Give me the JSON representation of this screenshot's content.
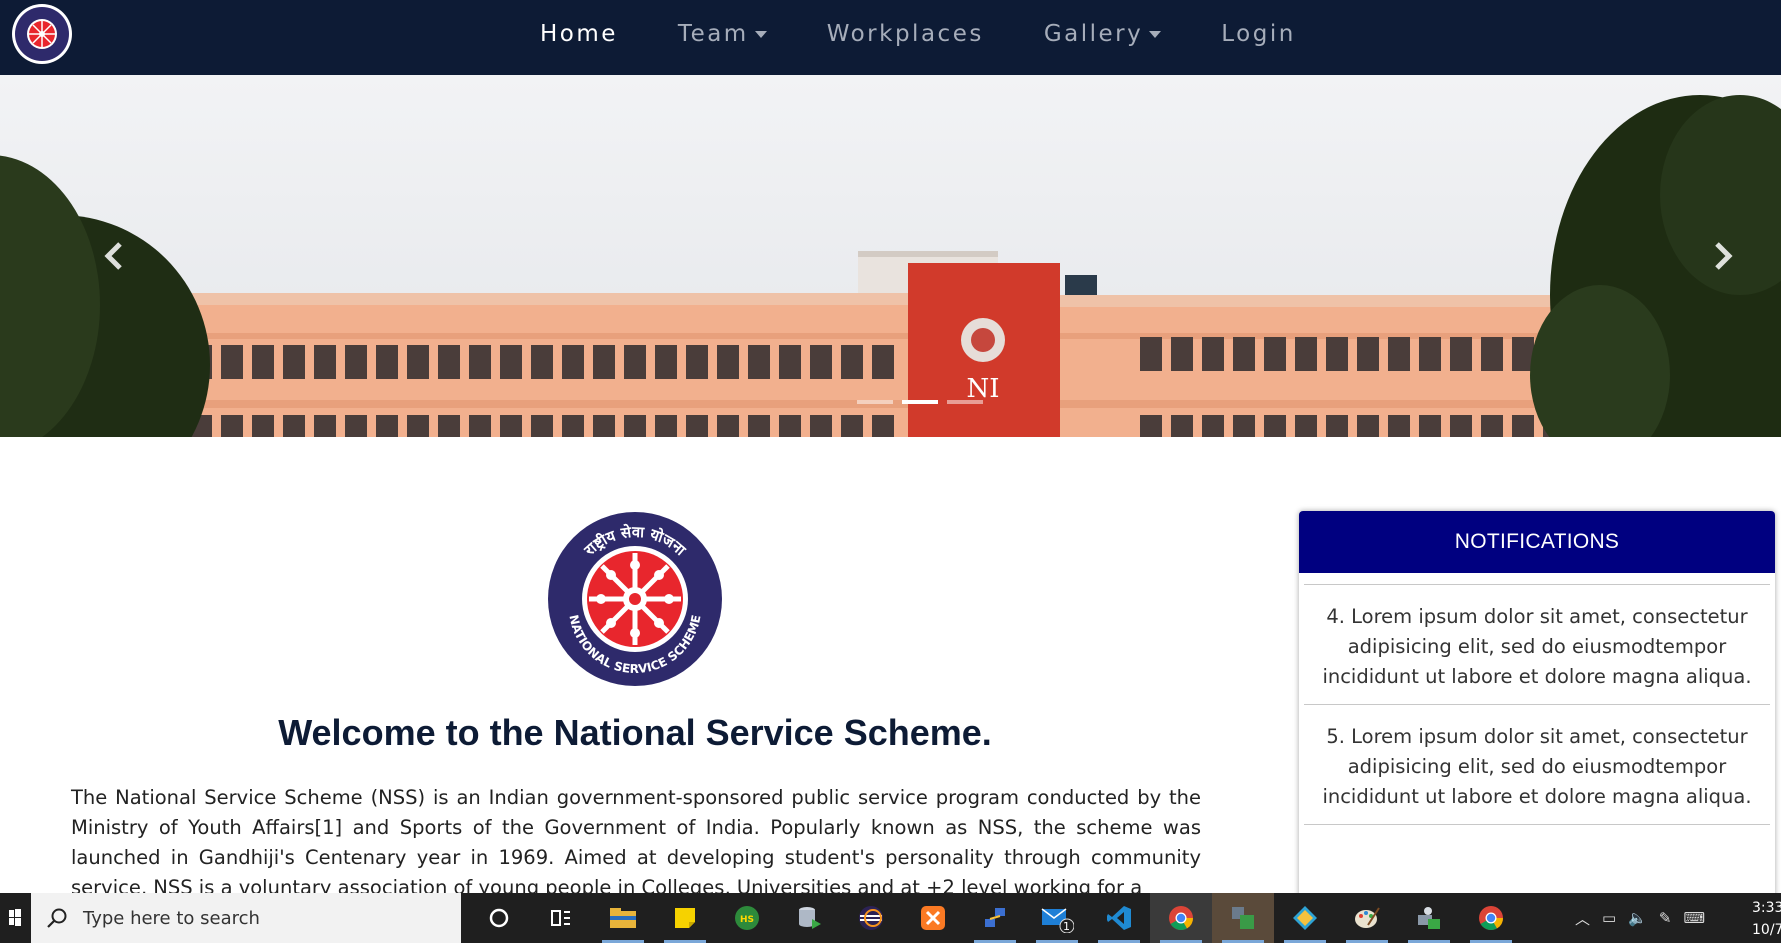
{
  "navbar": {
    "logo_icon": "nss-emblem-icon",
    "links": [
      {
        "label": "Home",
        "active": true,
        "dropdown": false
      },
      {
        "label": "Team",
        "active": false,
        "dropdown": true
      },
      {
        "label": "Workplaces",
        "active": false,
        "dropdown": false
      },
      {
        "label": "Gallery",
        "active": false,
        "dropdown": true
      },
      {
        "label": "Login",
        "active": false,
        "dropdown": false
      }
    ],
    "bg_color": "#0d1b35"
  },
  "hero": {
    "prev_icon": "chevron-left-icon",
    "next_icon": "chevron-right-icon",
    "slides_count": 3,
    "active_slide": 2,
    "building_sign": "NI"
  },
  "main": {
    "logo": {
      "top_text": "राष्ट्रीय सेवा योजना",
      "bottom_text": "NATIONAL SERVICE SCHEME"
    },
    "welcome_title": "Welcome to the National Service Scheme.",
    "intro": "The National Service Scheme (NSS) is an Indian government-sponsored public service program conducted by the Ministry of Youth Affairs[1] and Sports of the Government of India. Popularly known as NSS, the scheme was launched in Gandhiji's Centenary year in 1969. Aimed at developing student's personality through community service, NSS is a voluntary association of young people in Colleges, Universities and at +2 level working for a"
  },
  "notifications": {
    "title": "NOTIFICATIONS",
    "header_color": "#000080",
    "items": [
      "4. Lorem ipsum dolor sit amet, consectetur adipisicing elit, sed do eiusmodtempor incididunt ut labore et dolore magna aliqua.",
      "5. Lorem ipsum dolor sit amet, consectetur adipisicing elit, sed do eiusmodtempor incididunt ut labore et dolore magna aliqua."
    ]
  },
  "taskbar": {
    "search_placeholder": "Type here to search",
    "mail_badge": "1",
    "clock_time": "3:33",
    "clock_date": "10/7,",
    "icons": [
      "cortana-icon",
      "task-view-icon",
      "file-explorer-icon",
      "sticky-notes-icon",
      "hs-app-icon",
      "database-icon",
      "eclipse-icon",
      "xampp-icon",
      "network-icon",
      "mail-icon",
      "vscode-icon",
      "chrome-icon",
      "app-switch-icon",
      "git-icon",
      "paint-icon",
      "network-manager-icon",
      "chrome-icon"
    ]
  }
}
